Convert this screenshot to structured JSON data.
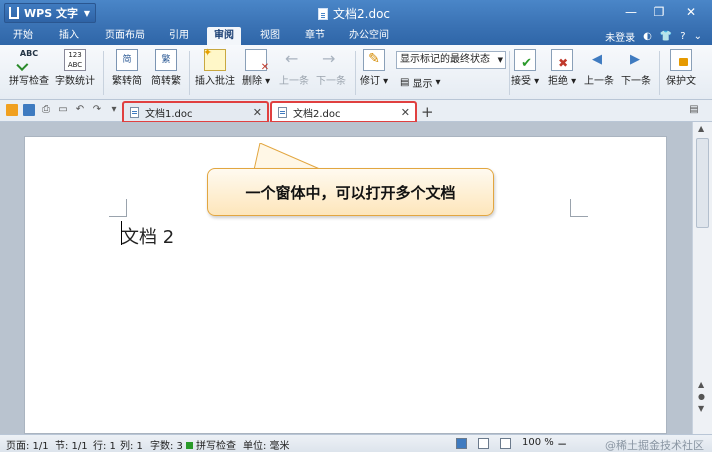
{
  "app": {
    "name": "WPS 文字",
    "doc_title": "文档2.doc"
  },
  "menu": {
    "tabs": [
      "开始",
      "插入",
      "页面布局",
      "引用",
      "审阅",
      "视图",
      "章节",
      "办公空间"
    ],
    "active_tab": "审阅",
    "login": "未登录"
  },
  "ribbon": {
    "spell_check": "拼写检查",
    "word_count": "字数统计",
    "trad_to_simp": "繁转简",
    "simp_to_trad": "简转繁",
    "insert_comment": "插入批注",
    "delete": "删除",
    "prev_item": "上一条",
    "next_item": "下一条",
    "revise": "修订",
    "markup_combo": "显示标记的最终状态",
    "show": "显示",
    "accept": "接受",
    "reject": "拒绝",
    "prev": "上一条",
    "next": "下一条",
    "protect": "保护文"
  },
  "doc_tabs": [
    {
      "label": "文档1.doc"
    },
    {
      "label": "文档2.doc"
    }
  ],
  "document": {
    "text": "文档 2"
  },
  "callout": {
    "text": "一个窗体中，可以打开多个文档"
  },
  "status": {
    "page": "页面: 1/1",
    "section": "节: 1/1",
    "line": "行: 1",
    "column": "列: 1",
    "word_count": "字数: 3",
    "spell_check": "拼写检查",
    "unit": "单位: 毫米",
    "zoom": "100 %",
    "watermark": "@稀土掘金技术社区"
  }
}
